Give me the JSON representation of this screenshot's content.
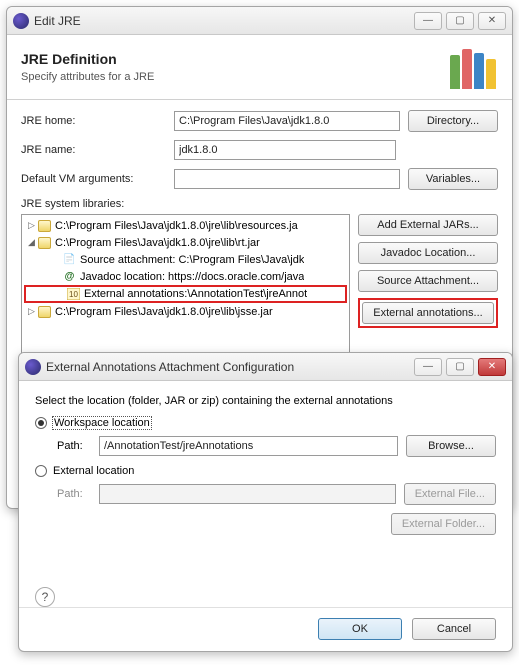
{
  "window1": {
    "title": "Edit JRE",
    "header_title": "JRE Definition",
    "header_sub": "Specify attributes for a JRE",
    "jre_home_label": "JRE home:",
    "jre_home_value": "C:\\Program Files\\Java\\jdk1.8.0",
    "directory_btn": "Directory...",
    "jre_name_label": "JRE name:",
    "jre_name_value": "jdk1.8.0",
    "vm_args_label": "Default VM arguments:",
    "vm_args_value": "",
    "variables_btn": "Variables...",
    "lib_label": "JRE system libraries:",
    "tree": {
      "n0": "C:\\Program Files\\Java\\jdk1.8.0\\jre\\lib\\resources.ja",
      "n1": "C:\\Program Files\\Java\\jdk1.8.0\\jre\\lib\\rt.jar",
      "n1a": "Source attachment: C:\\Program Files\\Java\\jdk",
      "n1b": "Javadoc location: https://docs.oracle.com/java",
      "n1c": "External annotations:\\AnnotationTest\\jreAnnot",
      "n2": "C:\\Program Files\\Java\\jdk1.8.0\\jre\\lib\\jsse.jar"
    },
    "btns": {
      "add_ext": "Add External JARs...",
      "javadoc": "Javadoc Location...",
      "source": "Source Attachment...",
      "extann": "External annotations..."
    }
  },
  "window2": {
    "title": "External Annotations Attachment Configuration",
    "prompt": "Select the location (folder, JAR or zip) containing the external annotations",
    "workspace_label": "Workspace location",
    "path_label": "Path:",
    "path_value": "/AnnotationTest/jreAnnotations",
    "browse_btn": "Browse...",
    "external_label": "External location",
    "path2_label": "Path:",
    "path2_value": "",
    "ext_file_btn": "External File...",
    "ext_folder_btn": "External Folder...",
    "ok_btn": "OK",
    "cancel_btn": "Cancel"
  }
}
